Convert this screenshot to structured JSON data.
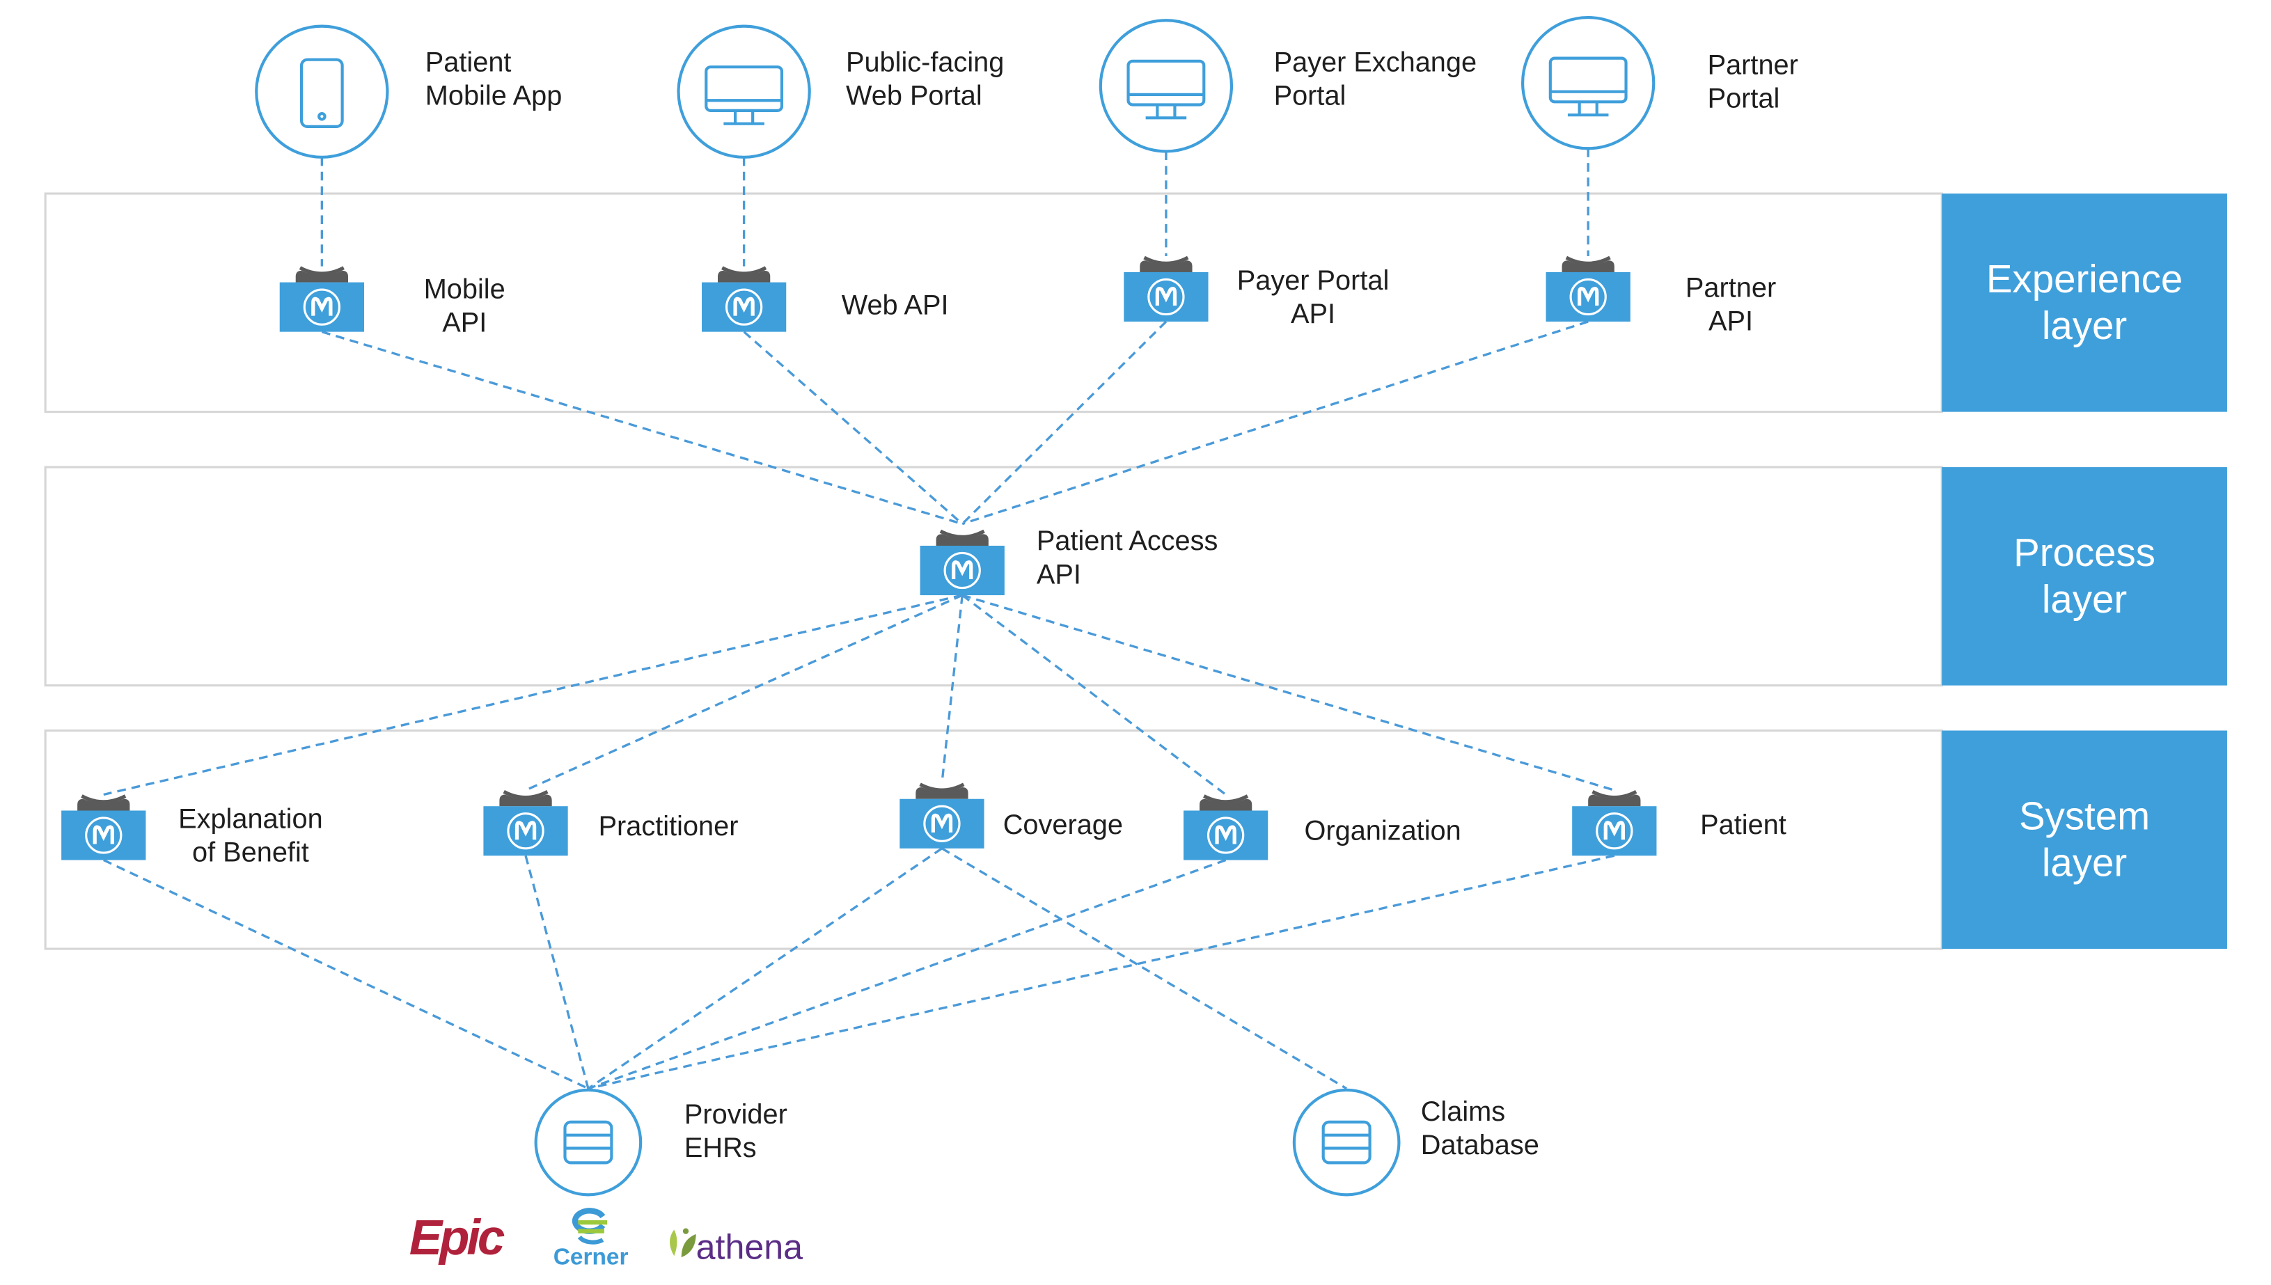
{
  "colors": {
    "accent": "#3f9fdb",
    "connector": "#4a9ad8",
    "icon_cap": "#5a5a5a",
    "epic": "#b0223b",
    "cerner": "#3c9ad6",
    "athena": "#5b2d86"
  },
  "layers": [
    {
      "label_lines": [
        "Experience",
        "layer"
      ]
    },
    {
      "label_lines": [
        "Process",
        "layer"
      ]
    },
    {
      "label_lines": [
        "System",
        "layer"
      ]
    }
  ],
  "channels": [
    {
      "icon": "mobile-phone-icon",
      "lines": [
        "Patient",
        "Mobile App"
      ]
    },
    {
      "icon": "monitor-icon",
      "lines": [
        "Public-facing",
        "Web Portal"
      ]
    },
    {
      "icon": "monitor-icon",
      "lines": [
        "Payer Exchange",
        "Portal"
      ]
    },
    {
      "icon": "monitor-icon",
      "lines": [
        "Partner",
        "Portal"
      ]
    }
  ],
  "experience_apis": [
    {
      "lines": [
        "Mobile",
        "API"
      ]
    },
    {
      "lines": [
        "Web API"
      ]
    },
    {
      "lines": [
        "Payer Portal",
        "API"
      ]
    },
    {
      "lines": [
        "Partner",
        "API"
      ]
    }
  ],
  "process_api": {
    "lines": [
      "Patient Access",
      "API"
    ]
  },
  "system_apis": [
    {
      "lines": [
        "Explanation",
        "of Benefit"
      ]
    },
    {
      "lines": [
        "Practitioner"
      ]
    },
    {
      "lines": [
        "Coverage"
      ]
    },
    {
      "lines": [
        "Organization"
      ]
    },
    {
      "lines": [
        "Patient"
      ]
    }
  ],
  "backends": [
    {
      "icon": "database-icon",
      "lines": [
        "Provider",
        "EHRs"
      ]
    },
    {
      "icon": "database-icon",
      "lines": [
        "Claims",
        "Database"
      ]
    }
  ],
  "vendor_logos": [
    "Epic",
    "Cerner",
    "athena"
  ]
}
